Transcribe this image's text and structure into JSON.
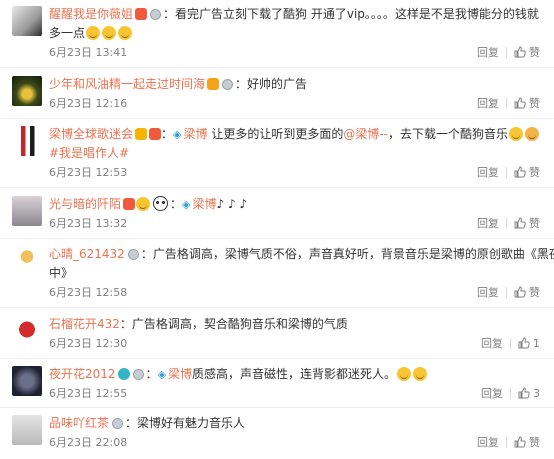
{
  "comments": [
    {
      "user": "醒醒我是你薇姐",
      "sep": "：",
      "text": "看完广告立刻下载了酷狗 开通了vip。。。。这样是不是我博能分的钱就",
      "text2": "多一点",
      "date": "6月23日 13:41",
      "reply": "回复",
      "like": "赞",
      "like_count": ""
    },
    {
      "user": "少年和风油精一起走过时间海",
      "sep": "：",
      "text": "好帅的广告",
      "date": "6月23日 12:16",
      "reply": "回复",
      "like": "赞",
      "like_count": ""
    },
    {
      "user": "梁博全球歌迷会",
      "sep": "：",
      "link": "梁博",
      "text": " 让更多的让听到更多面的",
      "mention": "@梁博--",
      "text_tail": "，去下载一个酷狗音乐",
      "text2": "#我是唱作人#",
      "date": "6月23日 12:53",
      "reply": "回复",
      "like": "赞",
      "like_count": ""
    },
    {
      "user": "光与暗的阡陌",
      "sep": "：",
      "link": "梁博",
      "text": "♪ ♪ ♪",
      "date": "6月23日 13:32",
      "reply": "回复",
      "like": "赞",
      "like_count": ""
    },
    {
      "user": "心晴_621432",
      "sep": "：",
      "text": "广告格调高，梁博气质不俗，声音真好听，背景音乐是梁博的原创歌曲《黑夜",
      "text2": "中》",
      "date": "6月23日 12:58",
      "reply": "回复",
      "like": "赞",
      "like_count": ""
    },
    {
      "user": "石榴花开432",
      "sep": "：",
      "text": "广告格调高，契合酷狗音乐和梁博的气质",
      "date": "6月23日 12:30",
      "reply": "回复",
      "like": "",
      "like_count": "1"
    },
    {
      "user": "夜开花2012",
      "sep": "：",
      "link": "梁博",
      "text": "质感高，声音磁性，连背影都迷死人。",
      "date": "6月23日 12:55",
      "reply": "回复",
      "like": "",
      "like_count": "3"
    },
    {
      "user": "品味吖红茶",
      "sep": "：",
      "text": "梁博好有魅力音乐人",
      "date": "6月23日 22:08",
      "reply": "回复",
      "like": "赞",
      "like_count": ""
    }
  ],
  "colors": {
    "username": "#eb7350",
    "link": "#eb7350",
    "meta": "#808080"
  }
}
